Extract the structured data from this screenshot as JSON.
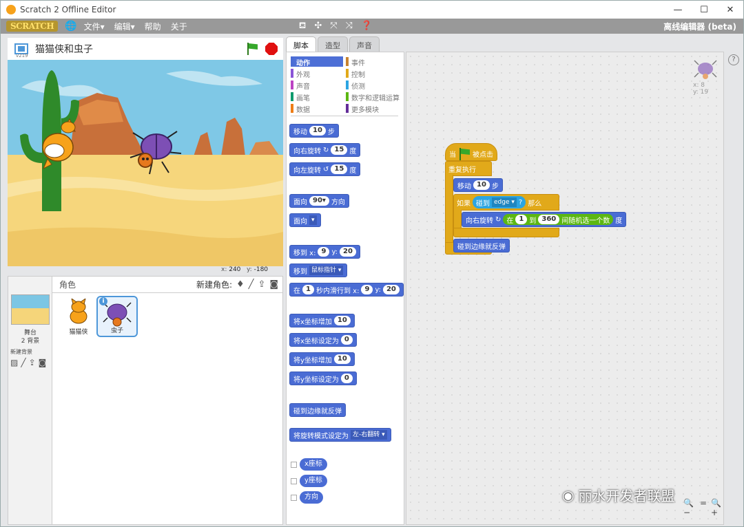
{
  "window": {
    "title": "Scratch 2 Offline Editor",
    "minimize": "—",
    "maximize": "☐",
    "close": "✕"
  },
  "menubar": {
    "logo": "SCRATCH",
    "items": [
      "文件▾",
      "编辑▾",
      "帮助",
      "关于"
    ],
    "offline_label": "离线编辑器 (beta)"
  },
  "stage_header": {
    "version": "v219",
    "project_name": "猫猫侠和虫子"
  },
  "stage": {
    "mouse_x_label": "x:",
    "mouse_x": "240",
    "mouse_y_label": "y:",
    "mouse_y": "-180"
  },
  "sprites_pane": {
    "title": "角色",
    "new_sprite_label": "新建角色:",
    "stage_label": "舞台",
    "stage_backdrops": "2 背景",
    "new_backdrop_label": "新建背景",
    "sprites": [
      {
        "name": "猫猫侠",
        "selected": false
      },
      {
        "name": "虫子",
        "selected": true
      }
    ]
  },
  "tabs": [
    "脚本",
    "造型",
    "声音"
  ],
  "categories": [
    {
      "label": "动作",
      "color": "#4a6cd4"
    },
    {
      "label": "事件",
      "color": "#c88330"
    },
    {
      "label": "外观",
      "color": "#8a55d7"
    },
    {
      "label": "控制",
      "color": "#e1a91a"
    },
    {
      "label": "声音",
      "color": "#bb42c3"
    },
    {
      "label": "侦测",
      "color": "#2ca5e2"
    },
    {
      "label": "画笔",
      "color": "#0e9a6c"
    },
    {
      "label": "数字和逻辑运算",
      "color": "#5cb712"
    },
    {
      "label": "数据",
      "color": "#ee7d16"
    },
    {
      "label": "更多模块",
      "color": "#632d99"
    }
  ],
  "palette": {
    "move": {
      "text": "移动",
      "value": "10",
      "suffix": "步"
    },
    "turn_right": {
      "text": "向右旋转",
      "arrow": "↻",
      "value": "15",
      "suffix": "度"
    },
    "turn_left": {
      "text": "向左旋转",
      "arrow": "↺",
      "value": "15",
      "suffix": "度"
    },
    "point_dir": {
      "text": "面向",
      "value": "90▾",
      "suffix": "方向"
    },
    "point_towards": {
      "text": "面向",
      "value": "▾"
    },
    "goto_xy": {
      "text": "移到 x:",
      "x": "9",
      "y_label": "y:",
      "y": "20"
    },
    "goto": {
      "text": "移到",
      "value": "鼠标指针 ▾"
    },
    "glide": {
      "text": "在",
      "secs": "1",
      "mid": "秒内滑行到 x:",
      "x": "9",
      "y_label": "y:",
      "y": "20"
    },
    "change_x": {
      "text": "将x坐标增加",
      "value": "10"
    },
    "set_x": {
      "text": "将x坐标设定为",
      "value": "0"
    },
    "change_y": {
      "text": "将y坐标增加",
      "value": "10"
    },
    "set_y": {
      "text": "将y坐标设定为",
      "value": "0"
    },
    "bounce": {
      "text": "碰到边缘就反弹"
    },
    "rotation_style": {
      "text": "将旋转模式设定为",
      "value": "左-右翻转 ▾"
    },
    "reporters": [
      "x座标",
      "y座标",
      "方向"
    ]
  },
  "sprite_info": {
    "x_label": "x:",
    "x": "8",
    "y_label": "y:",
    "y": "19"
  },
  "script": {
    "hat_when": "当",
    "hat_clicked": "被点击",
    "forever": "重复执行",
    "move_text": "移动",
    "move_value": "10",
    "move_suffix": "步",
    "if_text": "如果",
    "touching_text": "碰到",
    "touching_value": "edge ▾",
    "touching_q": "?",
    "then_text": "那么",
    "turn_text": "向右旋转",
    "turn_arrow": "↻",
    "rand_in": "在",
    "rand_from": "1",
    "rand_to_label": "到",
    "rand_to": "360",
    "rand_suffix": "间随机选一个数",
    "turn_suffix": "度",
    "bounce_text": "碰到边缘就反弹",
    "loop_arrow": "↲"
  },
  "zoom": {
    "out": "🔍−",
    "reset": "=",
    "in": "🔍+"
  },
  "watermark": "丽水开发者联盟",
  "help_icon": "?"
}
